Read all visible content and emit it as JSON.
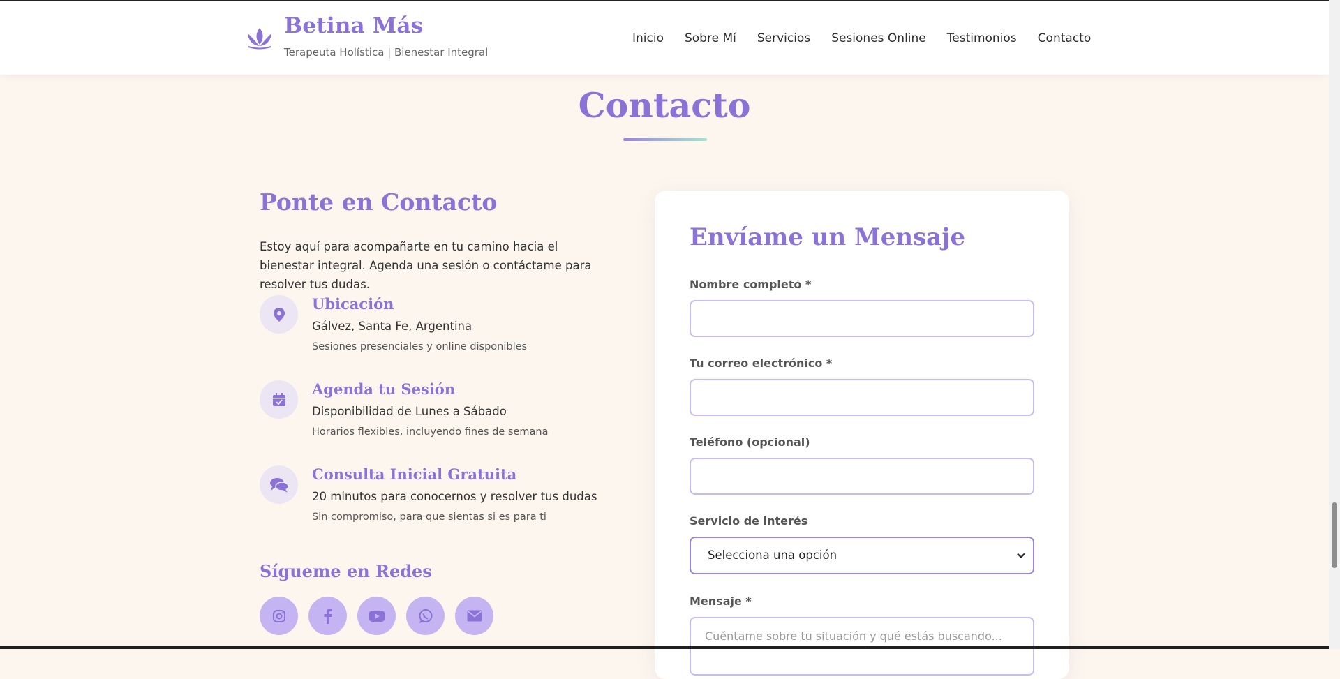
{
  "header": {
    "brand_name": "Betina Más",
    "brand_tagline": "Terapeuta Holística | Bienestar Integral",
    "nav": [
      "Inicio",
      "Sobre Mí",
      "Servicios",
      "Sesiones Online",
      "Testimonios",
      "Contacto"
    ]
  },
  "section": {
    "title": "Contacto"
  },
  "left": {
    "heading": "Ponte en Contacto",
    "intro": "Estoy aquí para acompañarte en tu camino hacia el bienestar integral. Agenda una sesión o contáctame para resolver tus dudas.",
    "items": [
      {
        "icon": "location-pin-icon",
        "title": "Ubicación",
        "line1": "Gálvez, Santa Fe, Argentina",
        "line2": "Sesiones presenciales y online disponibles"
      },
      {
        "icon": "calendar-check-icon",
        "title": "Agenda tu Sesión",
        "line1": "Disponibilidad de Lunes a Sábado",
        "line2": "Horarios flexibles, incluyendo fines de semana"
      },
      {
        "icon": "chat-bubbles-icon",
        "title": "Consulta Inicial Gratuita",
        "line1": "20 minutos para conocernos y resolver tus dudas",
        "line2": "Sin compromiso, para que sientas si es para ti"
      }
    ],
    "social_heading": "Sígueme en Redes",
    "social_icons": [
      "instagram-icon",
      "facebook-icon",
      "youtube-icon",
      "whatsapp-icon",
      "email-icon"
    ]
  },
  "form": {
    "title": "Envíame un Mensaje",
    "name_label": "Nombre completo *",
    "email_label": "Tu correo electrónico *",
    "phone_label": "Teléfono (opcional)",
    "service_label": "Servicio de interés",
    "service_selected": "Selecciona una opción",
    "message_label": "Mensaje *",
    "message_placeholder": "Cuéntame sobre tu situación y qué estás buscando..."
  },
  "colors": {
    "accent": "#8a72d6",
    "background": "#fdf6ee",
    "social_bg": "#c4b5f2",
    "icon_bg": "#ece5f3"
  }
}
